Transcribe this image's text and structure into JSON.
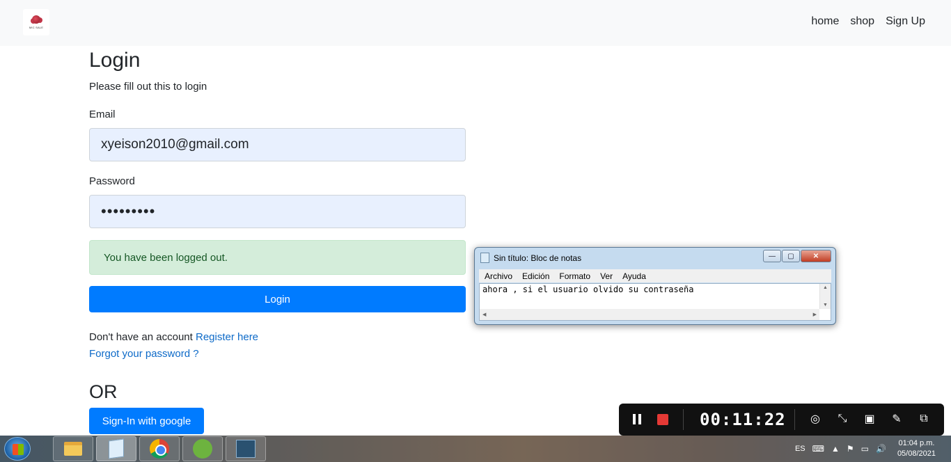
{
  "navbar": {
    "logo_text": "MIC SALE",
    "links": [
      "home",
      "shop",
      "Sign Up"
    ]
  },
  "login": {
    "title": "Login",
    "subtitle": "Please fill out this to login",
    "email_label": "Email",
    "email_value": "xyeison2010@gmail.com",
    "password_label": "Password",
    "password_value": "•••••••••",
    "alert": "You have been logged out.",
    "login_button": "Login",
    "no_account_text": "Don't have an account",
    "register_link": "Register here",
    "forgot_link": "Forgot your password ?",
    "or_text": "OR",
    "google_button": "Sign-In with google"
  },
  "notepad": {
    "title": "Sin título: Bloc de notas",
    "menu": [
      "Archivo",
      "Edición",
      "Formato",
      "Ver",
      "Ayuda"
    ],
    "content": "ahora , si el usuario olvido su contraseña",
    "controls": {
      "minimize": "—",
      "maximize": "▢",
      "close": "✕"
    }
  },
  "recorder": {
    "time": "00:11:22",
    "icons": [
      "pause-icon",
      "stop-icon",
      "screenshot-region-icon",
      "collapse-icon",
      "camera-icon",
      "pen-icon",
      "window-icon"
    ],
    "stop_color": "#e53935"
  },
  "taskbar": {
    "apps": [
      "file-explorer",
      "notepad",
      "chrome",
      "spring-tool-suite",
      "mysql-workbench"
    ],
    "language": "ES",
    "time": "01:04 p.m.",
    "date": "05/08/2021"
  },
  "colors": {
    "primary": "#007bff",
    "link": "#0d6ac8",
    "alert_bg": "#d4edda",
    "alert_text": "#155724",
    "input_bg": "#e8f0fe"
  }
}
